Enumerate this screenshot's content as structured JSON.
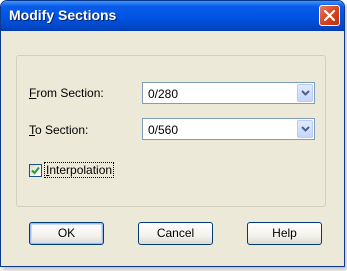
{
  "dialog": {
    "title": "Modify Sections",
    "close_glyph": "close-icon"
  },
  "fields": {
    "from_section": {
      "label_accel": "F",
      "label_rest": "rom Section:",
      "value": "0/280"
    },
    "to_section": {
      "label_accel": "T",
      "label_rest": "o Section:",
      "value": "0/560"
    }
  },
  "interpolation": {
    "label_accel": "I",
    "label_rest": "nterpolation",
    "checked": true
  },
  "buttons": {
    "ok": "OK",
    "cancel": "Cancel",
    "help": "Help"
  },
  "colors": {
    "title_bar": "#0054e3",
    "close_button": "#d9451f",
    "dialog_face": "#ece9d8",
    "check_mark": "#21a121"
  }
}
